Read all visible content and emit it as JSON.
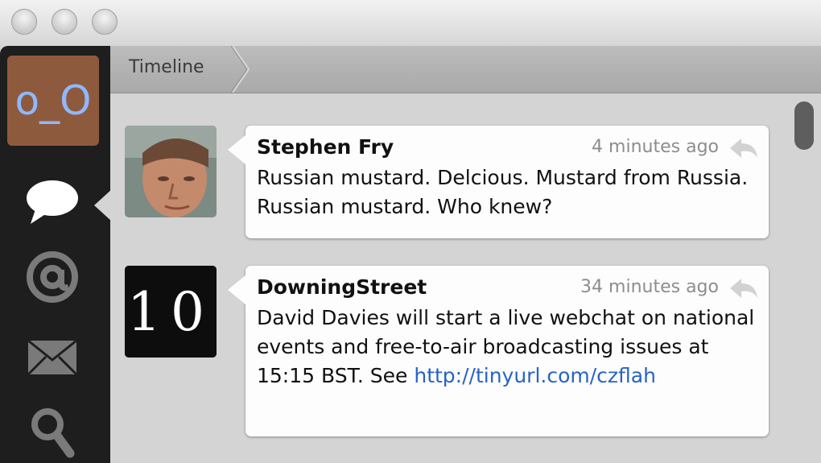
{
  "window": {
    "controls": [
      "close-button",
      "minimize-button",
      "zoom-button"
    ]
  },
  "sidebar": {
    "account_avatar_text": "o_O",
    "items": [
      {
        "icon": "speech-bubble-icon",
        "selected": true
      },
      {
        "icon": "at-icon",
        "selected": false
      },
      {
        "icon": "envelope-icon",
        "selected": false
      },
      {
        "icon": "search-icon",
        "selected": false
      }
    ]
  },
  "header": {
    "breadcrumb": "Timeline"
  },
  "tweets": [
    {
      "author": "Stephen Fry",
      "time": "4 minutes ago",
      "text": "Russian mustard. Delcious. Mustard from Russia. Russian mustard. Who knew?"
    },
    {
      "author": "DowningStreet",
      "time": "34 minutes ago",
      "avatar_text": "10",
      "text": "David Davies will start a live webchat on national events and free-to-air broadcasting issues at 15:15 BST. See ",
      "link": "http://tinyurl.com/czflah"
    }
  ],
  "colors": {
    "sidebar_bg": "#1e1e1e",
    "account_avatar_bg": "#8e5a3d",
    "link": "#2663c8"
  }
}
